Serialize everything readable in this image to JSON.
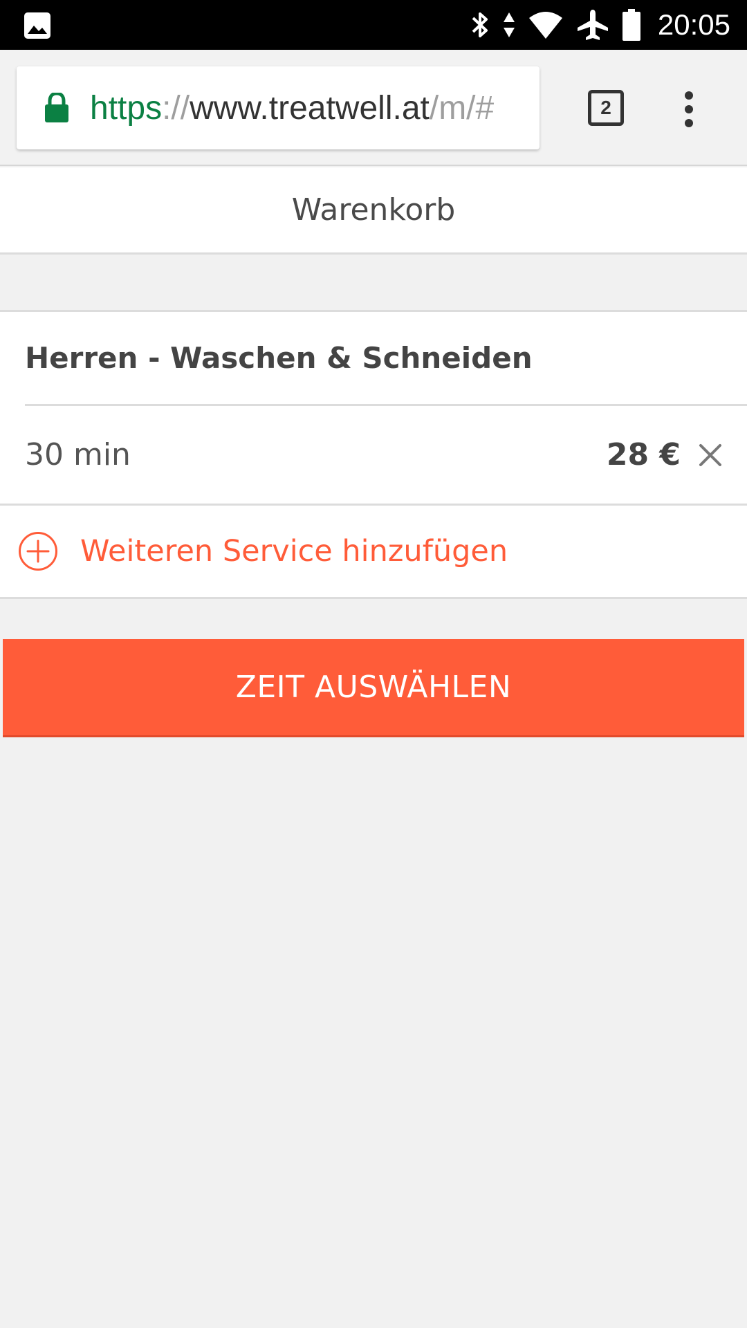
{
  "status_bar": {
    "left_icon": "image-icon",
    "right_icons": [
      "bluetooth-icon",
      "data-arrows-icon",
      "wifi-icon",
      "airplane-icon",
      "battery-icon"
    ],
    "time": "20:05"
  },
  "browser": {
    "url": {
      "scheme": "https",
      "separator": "://",
      "host": "www.treatwell.at",
      "path": "/m/#"
    },
    "tab_count": "2",
    "lock_color": "#0b8043"
  },
  "page": {
    "title": "Warenkorb"
  },
  "cart": {
    "service_name": "Herren - Waschen & Schneiden",
    "duration": "30 min",
    "price": "28 €",
    "add_service_label": "Weiteren Service hinzufügen"
  },
  "cta": {
    "label": "ZEIT AUSWÄHLEN",
    "color": "#ff5c39"
  }
}
